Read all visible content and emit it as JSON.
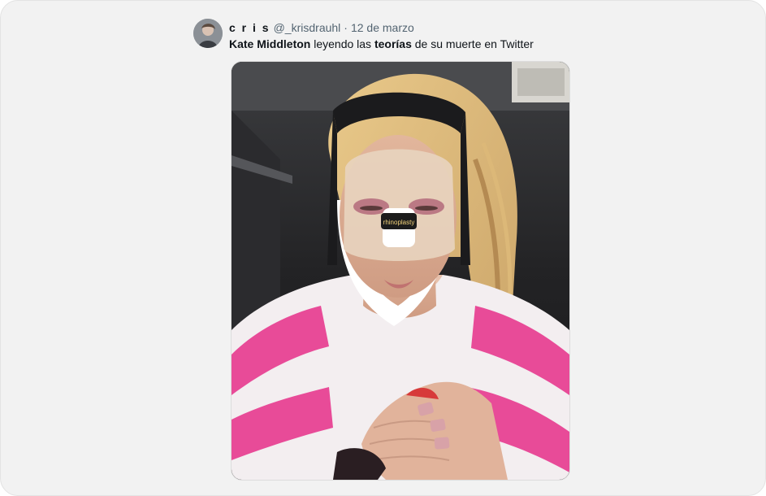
{
  "tweet": {
    "author": {
      "display_name": "c r i s",
      "handle": "@_krisdrauhl",
      "separator": "·",
      "date": "12 de marzo",
      "avatar_icon": "user-avatar"
    },
    "text_segments": [
      {
        "text": "Kate Middleton",
        "bold": true
      },
      {
        "text": " leyendo las ",
        "bold": false
      },
      {
        "text": "teorías",
        "bold": true
      },
      {
        "text": " de su muerte en Twitter",
        "bold": false
      }
    ],
    "media": {
      "type": "photo",
      "tape_text": "rhinoplasty"
    }
  },
  "colors": {
    "background": "#f2f2f2",
    "primary_text": "#0f1419",
    "secondary_text": "#536471",
    "sweater_pink": "#e84b98"
  }
}
